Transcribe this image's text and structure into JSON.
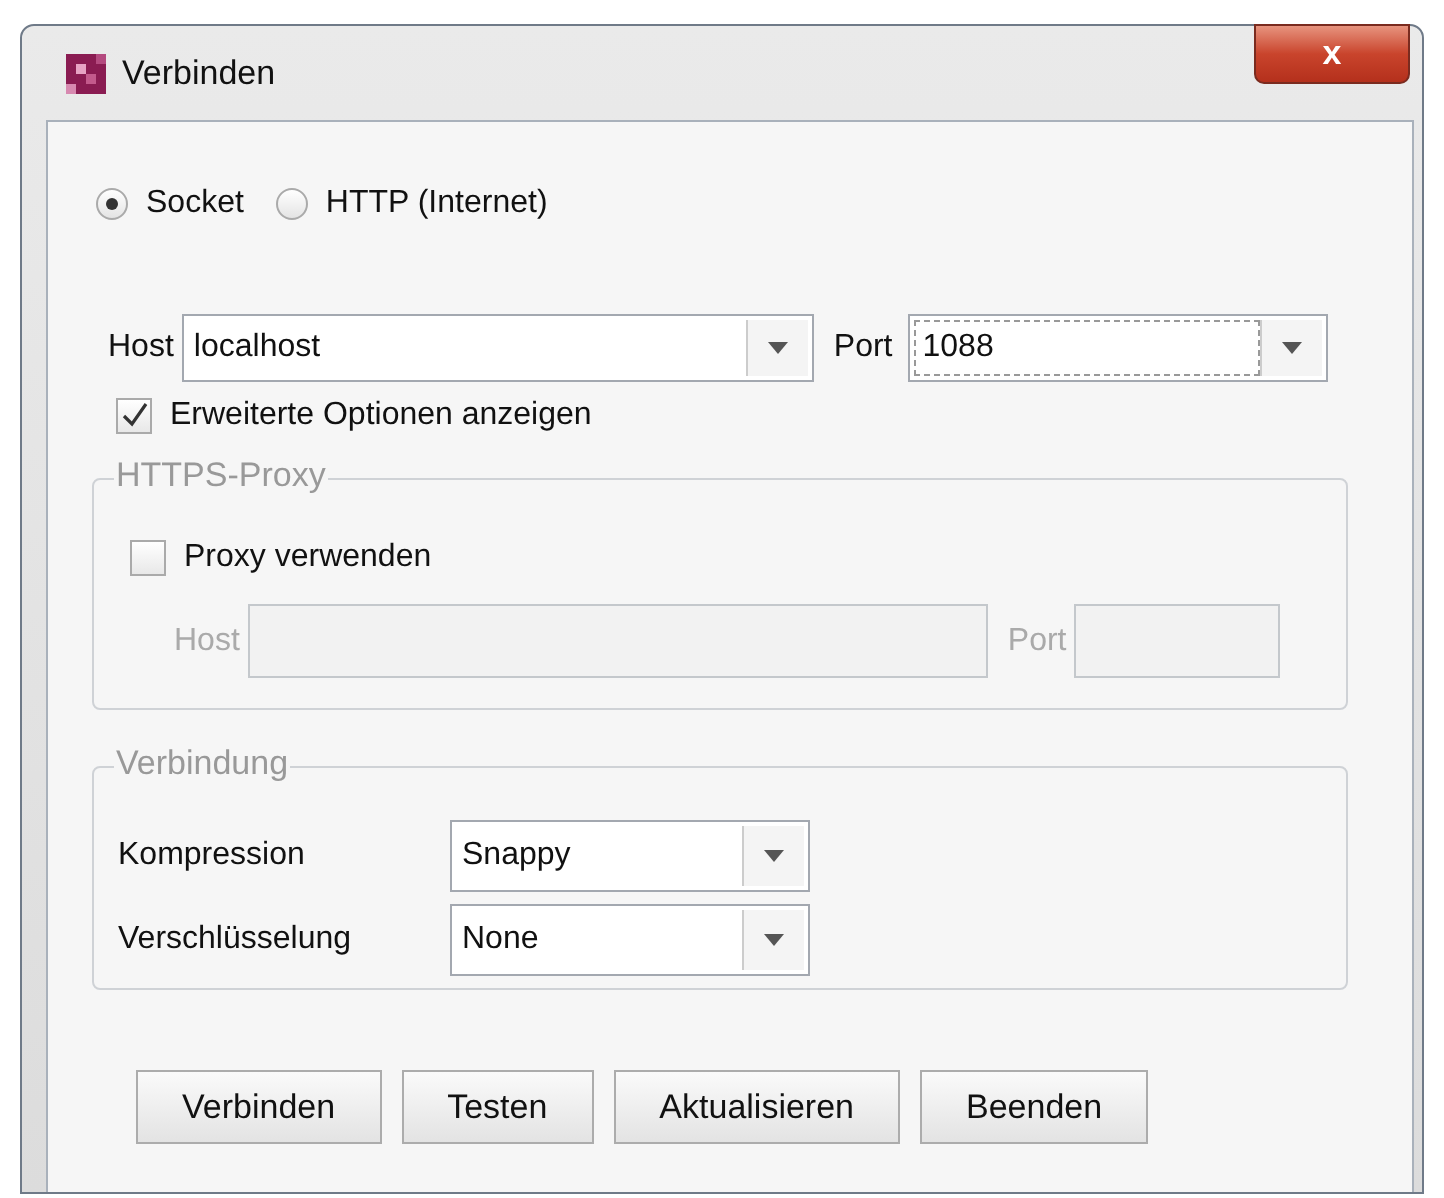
{
  "window": {
    "title": "Verbinden",
    "close": "x"
  },
  "mode": [
    {
      "label": "Socket",
      "selected": true
    },
    {
      "label": "HTTP (Internet)",
      "selected": false
    }
  ],
  "host": {
    "label": "Host",
    "value": "localhost"
  },
  "port": {
    "label": "Port",
    "value": "1088"
  },
  "advanced": {
    "label": "Erweiterte Optionen anzeigen",
    "checked": true
  },
  "proxy": {
    "title": "HTTPS-Proxy",
    "use": {
      "label": "Proxy verwenden",
      "checked": false
    },
    "host_label": "Host",
    "port_label": "Port",
    "disabled": true
  },
  "connection": {
    "title": "Verbindung",
    "rows": [
      {
        "label": "Kompression",
        "value": "Snappy"
      },
      {
        "label": "Verschlüsselung",
        "value": "None"
      }
    ]
  },
  "buttons": [
    "Verbinden",
    "Testen",
    "Aktualisieren",
    "Beenden"
  ]
}
